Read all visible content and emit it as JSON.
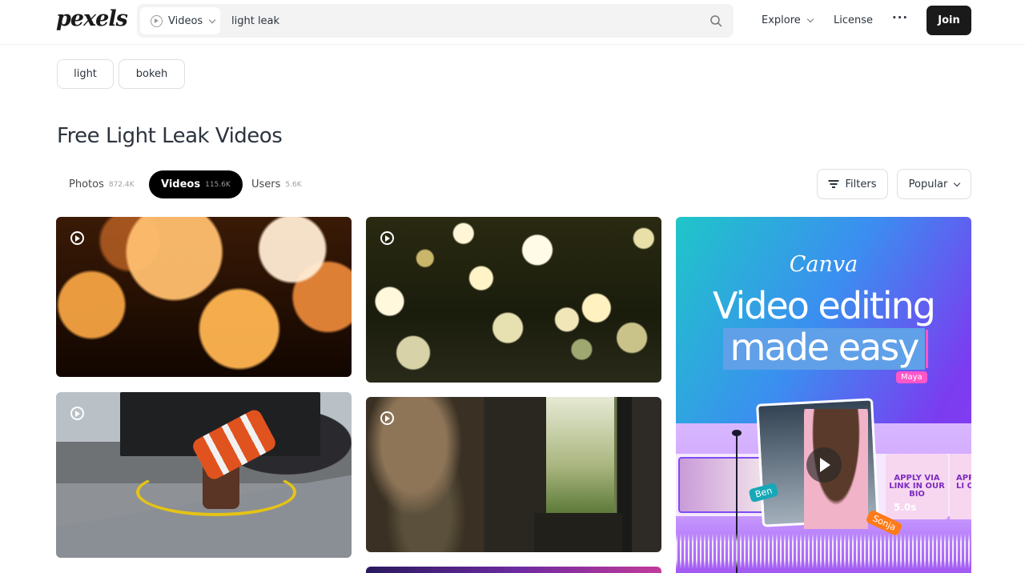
{
  "header": {
    "logo": "pexels",
    "search_type": "Videos",
    "search_value": "light leak",
    "explore": "Explore",
    "license": "License",
    "more": "···",
    "join": "Join"
  },
  "tags": [
    "light",
    "bokeh"
  ],
  "page_title": "Free Light Leak Videos",
  "tabs": [
    {
      "label": "Photos",
      "count": "872.4K"
    },
    {
      "label": "Videos",
      "count": "115.6K"
    },
    {
      "label": "Users",
      "count": "5.6K"
    }
  ],
  "filters_label": "Filters",
  "sort_label": "Popular",
  "ad": {
    "brand": "Canva",
    "headline_1": "Video editing",
    "headline_2": "made easy",
    "tag_maya": "Maya",
    "tag_ben": "Ben",
    "tag_sonja": "Sonja",
    "apply_text": "APPLY VIA LINK IN OUR BIO",
    "apply_text_2": "APP LI OU",
    "duration": "5.0s"
  },
  "colors": {
    "accent": "#000000",
    "text": "#2c343e",
    "border": "#dfdfe0"
  }
}
